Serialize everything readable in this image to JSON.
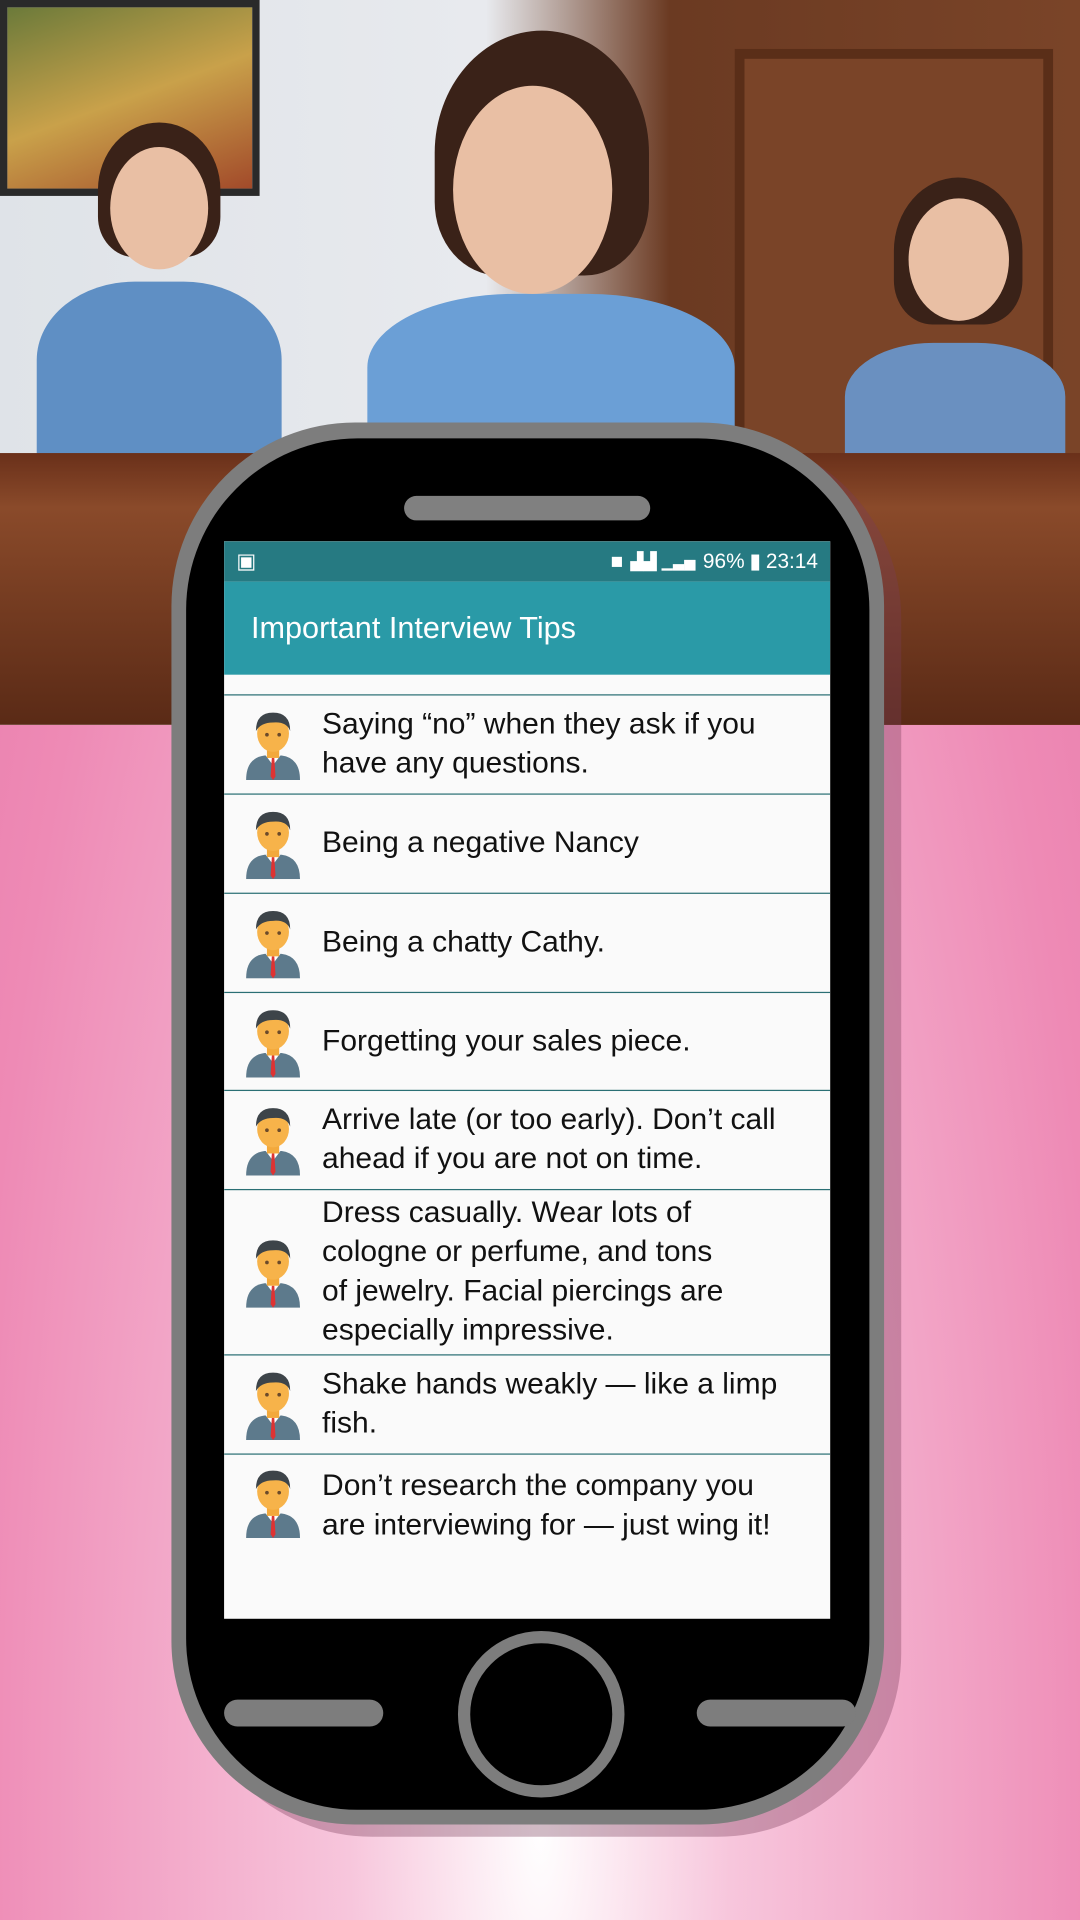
{
  "status_bar": {
    "left_icon": "image-icon",
    "icons": [
      "sim-card-icon",
      "signal-icon",
      "signal-icon"
    ],
    "battery": "96%",
    "time": "23:14"
  },
  "app_bar": {
    "title": "Important Interview Tips"
  },
  "list": {
    "icon": "businessman-icon",
    "items": [
      {
        "text": "Saying “no” when they ask if you\nhave any questions."
      },
      {
        "text": "Being a negative Nancy"
      },
      {
        "text": "Being a chatty Cathy."
      },
      {
        "text": "Forgetting your sales piece."
      },
      {
        "text": "Arrive late (or too early). Don’t call\nahead if you are not on time."
      },
      {
        "text": "Dress casually. Wear lots of\ncologne or perfume, and tons\nof jewelry. Facial piercings are\nespecially impressive."
      },
      {
        "text": "Shake hands weakly — like a limp\nfish."
      },
      {
        "text": "Don’t research the company you\nare interviewing for — just wing it!"
      }
    ]
  },
  "colors": {
    "status_bar": "#267a82",
    "app_bar": "#2a9aa7",
    "divider": "#2a6f74",
    "background_pink": "#ee8ab5"
  }
}
